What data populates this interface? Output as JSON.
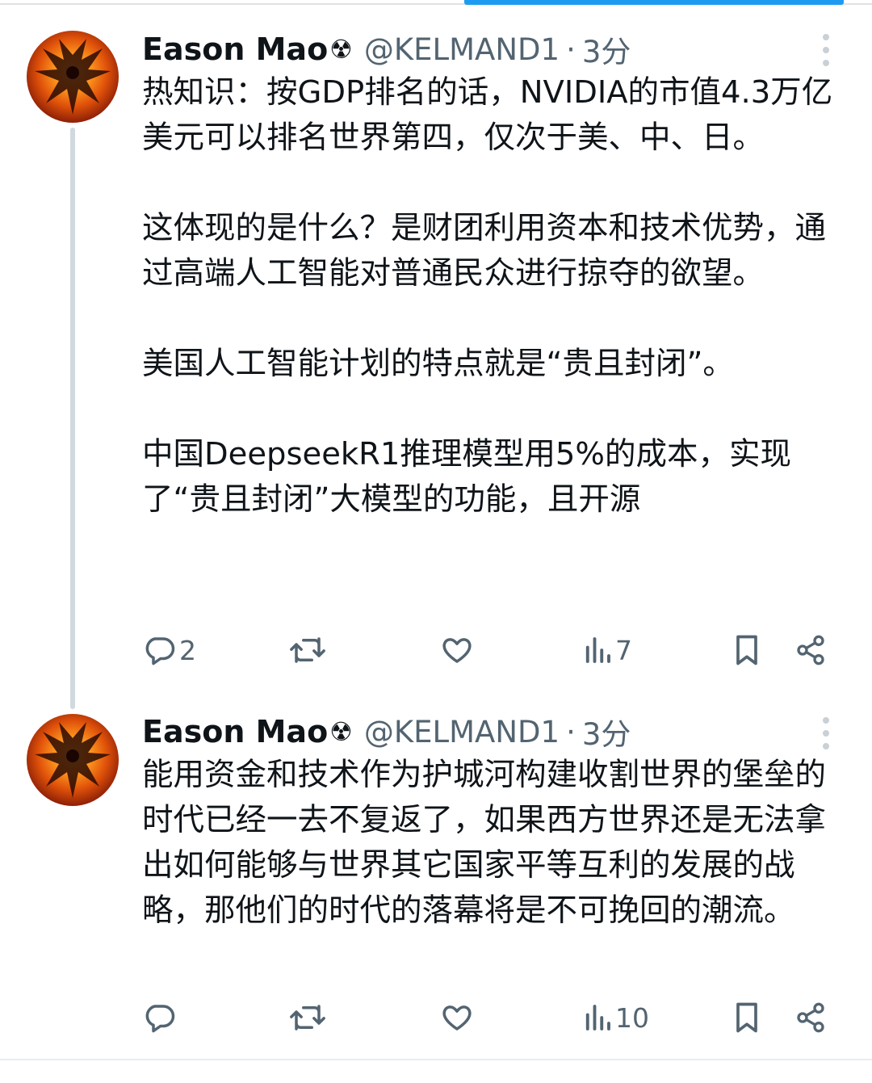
{
  "tweets": [
    {
      "author_name": "Eason Mao",
      "author_badge": "☢",
      "handle": "@KELMAND1",
      "separator": "·",
      "time": "3分",
      "paragraphs": [
        "热知识：按GDP排名的话，NVIDIA的市值4.3万亿美元可以排名世界第四，仅次于美、中、日。",
        "这体现的是什么？是财团利用资本和技术优势，通过高端人工智能对普通民众进行掠夺的欲望。",
        "美国人工智能计划的特点就是“贵且封闭”。",
        "中国DeepseekR1推理模型用5%的成本，实现了“贵且封闭”大模型的功能，且开源"
      ],
      "reply_count": "2",
      "retweet_count": "",
      "like_count": "",
      "view_count": "7"
    },
    {
      "author_name": "Eason Mao",
      "author_badge": "☢",
      "handle": "@KELMAND1",
      "separator": "·",
      "time": "3分",
      "paragraphs": [
        "能用资金和技术作为护城河构建收割世界的堡垒的时代已经一去不复返了，如果西方世界还是无法拿出如何能够与世界其它国家平等互利的发展的战略，那他们的时代的落幕将是不可挽回的潮流。"
      ],
      "reply_count": "",
      "retweet_count": "",
      "like_count": "",
      "view_count": "10"
    }
  ],
  "icons": {
    "reply": "reply-icon",
    "retweet": "retweet-icon",
    "like": "like-icon",
    "views": "views-icon",
    "bookmark": "bookmark-icon",
    "share": "share-icon",
    "more": "more-vertical-icon"
  },
  "colors": {
    "accent": "#1d9bf0",
    "text": "#0f1419",
    "muted": "#536471",
    "thread_line": "#cfd9de"
  }
}
